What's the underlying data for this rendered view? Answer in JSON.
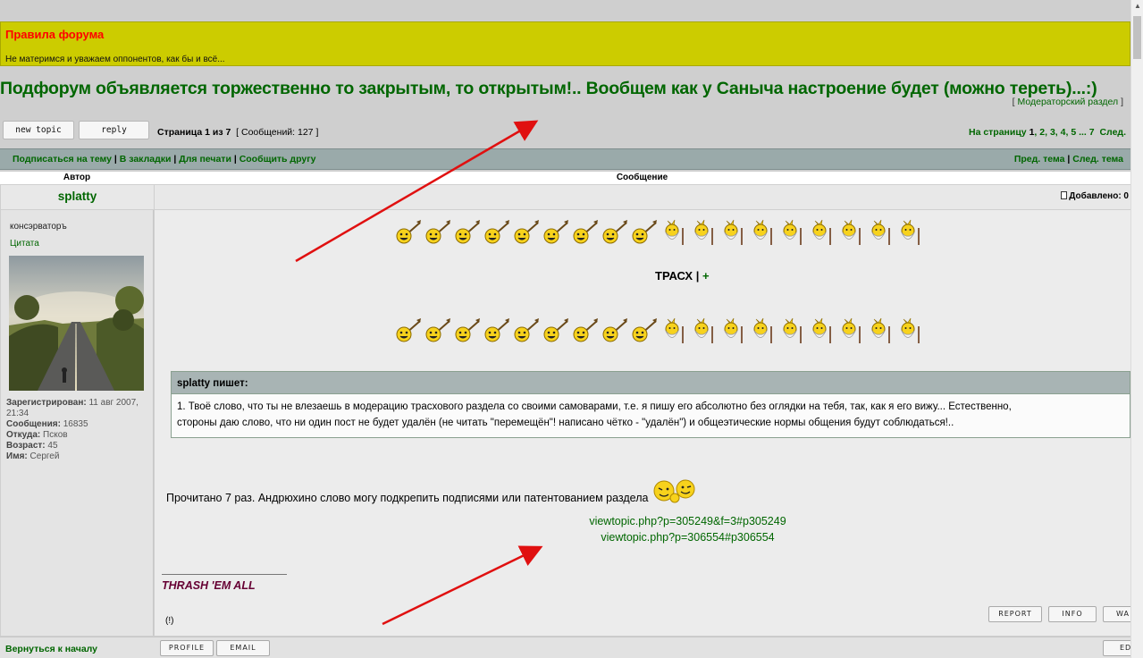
{
  "rules": {
    "title": "Правила форума",
    "text": "Не материмся и уважаем оппонентов, как бы и всё..."
  },
  "topic": {
    "title": "Подфорум объявляется торжественно то закрытым, то открытым!.. Вообщем как у Саныча настроение будет (можно тереть)...:)",
    "subforum_prefix": "[ ",
    "subforum_link": "Модераторский раздел",
    "subforum_suffix": " ]"
  },
  "toolbar": {
    "new_topic_label": "new topic",
    "reply_label": "reply",
    "page_prefix": "Страница ",
    "page_current": "1",
    "page_of": " из ",
    "page_total": "7",
    "messages": "[ Сообщений: 127 ]",
    "goto_label": "На страницу ",
    "pages": [
      "1",
      "2",
      "3",
      "4",
      "5",
      "7"
    ],
    "next_label": "След."
  },
  "actions": {
    "subscribe": "Подписаться на тему",
    "bookmark": "В закладки",
    "print": "Для печати",
    "tell_friend": "Сообщить другу",
    "prev_topic": "Пред. тема",
    "next_topic": "След. тема"
  },
  "table_header": {
    "author": "Автор",
    "message": "Сообщение"
  },
  "post": {
    "author": "splatty",
    "rank": "консэрваторъ",
    "quote_label": "Цитата",
    "added_label": "Добавлено: 0",
    "user_info": {
      "registered_label": "Зарегистрирован:",
      "registered_value": "11 авг 2007, 21:34",
      "messages_label": "Сообщения:",
      "messages_value": "16835",
      "from_label": "Откуда:",
      "from_value": "Псков",
      "age_label": "Возраст:",
      "age_value": "45",
      "name_label": "Имя:",
      "name_value": "Сергей"
    },
    "trash_label": "ТРАСХ",
    "trash_sep": " | ",
    "trash_plus": "+",
    "quote_header": "splatty пишет:",
    "quote_line1": "1. Твоё слово, что ты не влезаешь в модерацию трасхового раздела со своими самоварами, т.е. я пишу его абсолютно без оглядки на тебя, так, как я его вижу... Естественно,",
    "quote_line2": "стороны даю слово, что ни один пост не будет удалён (не читать \"перемещён\"! написано чётко - \"удалён\") и общеэтические нормы общения будут соблюдаться!..",
    "read_text": "Прочитано 7 раз. Андрюхино слово могу подкрепить подписями или патентованием раздела",
    "link1": "viewtopic.php?p=305249&f=3#p305249",
    "link2": "viewtopic.php?p=306554#p306554",
    "signature": "THRASH 'EM ALL",
    "exclaim": "(!)"
  },
  "buttons": {
    "report": "REPORT",
    "info": "INFO",
    "warn": "WA",
    "profile": "PROFILE",
    "email": "EMAIL",
    "edit": "ED"
  },
  "footer": {
    "back_to_top": "Вернуться к началу"
  },
  "colors": {
    "rules_bg": "#cccc00",
    "link_green": "#006600",
    "bar": "#9aaaaa",
    "arrow": "#e01010"
  }
}
